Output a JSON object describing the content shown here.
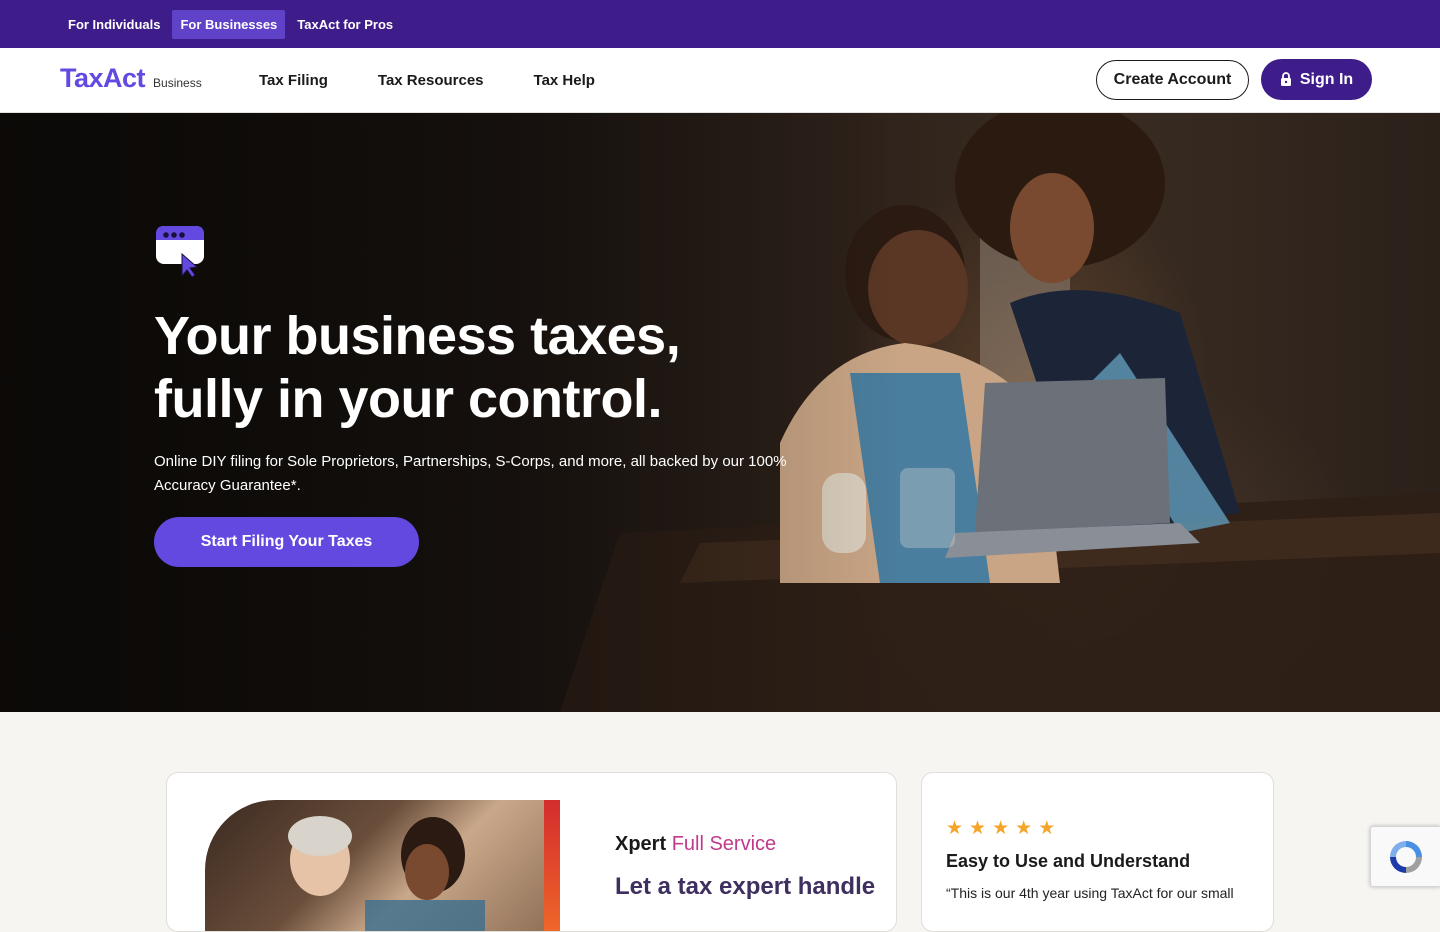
{
  "topbar": {
    "links": [
      {
        "label": "For Individuals",
        "active": false
      },
      {
        "label": "For Businesses",
        "active": true
      },
      {
        "label": "TaxAct for Pros",
        "active": false
      }
    ]
  },
  "nav": {
    "logo_text": "TaxAct",
    "logo_sub": "Business",
    "links": [
      "Tax Filing",
      "Tax Resources",
      "Tax Help"
    ],
    "create_account": "Create Account",
    "sign_in": "Sign In"
  },
  "hero": {
    "title_line1": "Your business taxes,",
    "title_line2": "fully in your control.",
    "subtitle": "Online DIY filing for Sole Proprietors, Partnerships, S-Corps, and more, all backed by our 100% Accuracy Guarantee*.",
    "cta": "Start Filing Your Taxes"
  },
  "xpert_card": {
    "brand_bold": "Xpert",
    "brand_light": "Full Service",
    "headline": "Let a tax expert handle"
  },
  "review_card": {
    "stars": 5,
    "title": "Easy to Use and Understand",
    "quote": "“This is our 4th year using TaxAct for our small"
  },
  "colors": {
    "brand_purple": "#3e1d8a",
    "accent_purple": "#6349e0",
    "star": "#f4a52a"
  }
}
